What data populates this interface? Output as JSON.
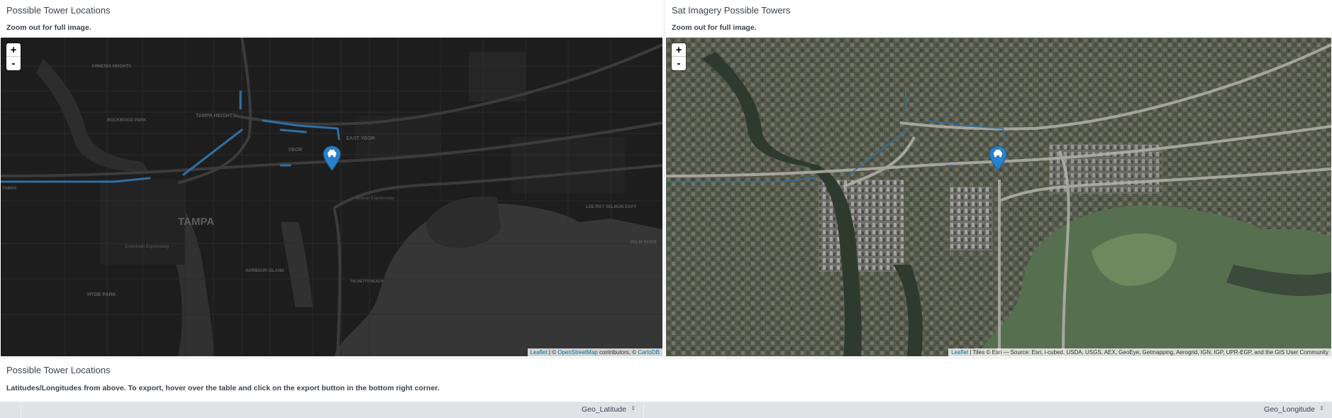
{
  "panels": {
    "left": {
      "title": "Possible Tower Locations",
      "description": "Zoom out for full image.",
      "attribution": {
        "leaflet": "Leaflet",
        "sep1": " | © ",
        "osm": "OpenStreetMap",
        "mid": " contributors, © ",
        "carto": "CartoDB"
      },
      "map_labels": [
        "TAMPA",
        "TAMPA HEIGHTS",
        "EAST YBOR",
        "YBOR",
        "ROCKWOOD PARK",
        "ARMENIA HEIGHTS",
        "HYDE PARK",
        "HARBOUR ISLAND",
        "PALM RIVER",
        "PALMETTO BEACH",
        "LEE ROY SELMON EXPY",
        "Crosstown Expressway",
        "Selmon Expressway",
        "TAMPA"
      ]
    },
    "right": {
      "title": "Sat Imagery Possible Towers",
      "description": "Zoom out for full image.",
      "attribution": {
        "leaflet": "Leaflet",
        "rest": " | Tiles © Esri — Source: Esri, i-cubed, USDA, USGS, AEX, GeoEye, Getmapping, Aerogrid, IGN, IGP, UPR-EGP, and the GIS User Community"
      }
    },
    "bottom": {
      "title": "Possible Tower Locations",
      "description": "Latitudes/Longitudes from above. To export, hover over the table and click on the export button in the bottom right corner.",
      "columns": [
        "Geo_Latitude",
        "Geo_Longitude"
      ],
      "sort_icon": "⇕"
    }
  },
  "zoom": {
    "in": "+",
    "out": "-"
  },
  "icons": {
    "marker": "car-marker-icon",
    "sort": "sort-icon"
  },
  "colors": {
    "marker": "#2a81cb",
    "track": "#2f6fa3",
    "dark_bg": "#1d1d1e",
    "sat_bg": "#53584a",
    "water_dark": "#3a3a3b",
    "water_sat": "#4f6a52"
  }
}
